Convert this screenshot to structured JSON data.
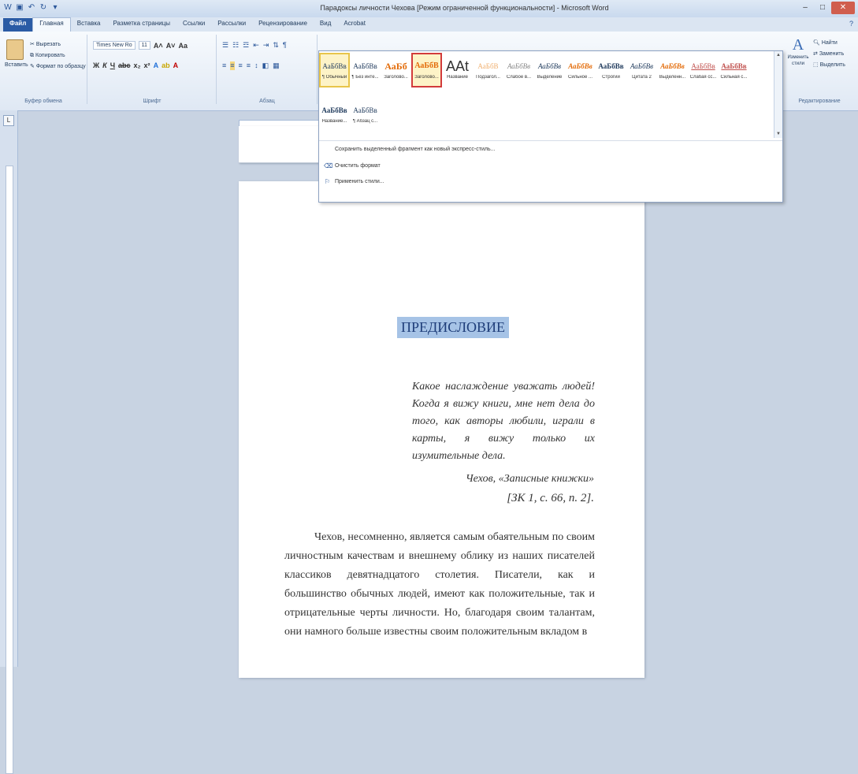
{
  "window": {
    "title": "Парадоксы личности Чехова [Режим ограниченной функциональности] - Microsoft Word"
  },
  "qat": [
    "word-icon",
    "save-icon",
    "undo-icon",
    "redo-icon",
    "customize-icon"
  ],
  "tabs": [
    {
      "label": "Файл"
    },
    {
      "label": "Главная"
    },
    {
      "label": "Вставка"
    },
    {
      "label": "Разметка страницы"
    },
    {
      "label": "Ссылки"
    },
    {
      "label": "Рассылки"
    },
    {
      "label": "Рецензирование"
    },
    {
      "label": "Вид"
    },
    {
      "label": "Acrobat"
    }
  ],
  "clipboard": {
    "paste": "Вставить",
    "cut": "Вырезать",
    "copy": "Копировать",
    "format_painter": "Формат по образцу",
    "group": "Буфер обмена"
  },
  "font": {
    "name": "Times New Ro",
    "size": "11",
    "group": "Шрифт"
  },
  "paragraph": {
    "group": "Абзац"
  },
  "editing": {
    "find": "Найти",
    "replace": "Заменить",
    "select": "Выделить",
    "change_styles": "Изменить стили",
    "group": "Редактирование"
  },
  "styles_row1": [
    {
      "sample": "АаБбВв",
      "name": "¶ Обычный"
    },
    {
      "sample": "АаБбВв",
      "name": "¶ Без инте..."
    },
    {
      "sample": "АаБб",
      "name": "Заголово..."
    },
    {
      "sample": "АаБбВ",
      "name": "Заголово..."
    },
    {
      "sample": "ААt",
      "name": "Название"
    },
    {
      "sample": "АаБбВ",
      "name": "Подзагол..."
    },
    {
      "sample": "АаБбВв",
      "name": "Слабое в..."
    },
    {
      "sample": "АаБбВв",
      "name": "Выделение"
    },
    {
      "sample": "АаБбВв",
      "name": "Сильное ..."
    },
    {
      "sample": "АаБбВв",
      "name": "Строгий"
    },
    {
      "sample": "АаБбВв",
      "name": "Цитата 2"
    },
    {
      "sample": "АаБбВв",
      "name": "Выделенн..."
    },
    {
      "sample": "АаБбВв",
      "name": "Слабая сс..."
    },
    {
      "sample": "АаБбВв",
      "name": "Сильная с..."
    }
  ],
  "styles_row2": [
    {
      "sample": "АаБбВв",
      "name": "Название..."
    },
    {
      "sample": "АаБбВв",
      "name": "¶ Абзац с..."
    }
  ],
  "gallery_commands": [
    {
      "label": "Сохранить выделенный фрагмент как новый экспресс-стиль..."
    },
    {
      "label": "Очистить формат"
    },
    {
      "label": "Применить стили..."
    }
  ],
  "document": {
    "heading": "ПРЕДИСЛОВИЕ",
    "epigraph": "Какое наслаждение уважать людей! Когда я вижу книги, мне нет дела до того, как авторы любили, играли в карты, я вижу только их изумительные дела.",
    "attribution1": "Чехов, «Записные книжки»",
    "attribution2": "[ЗК 1, с. 66, п. 2].",
    "body": "Чехов, несомненно, является самым обаятельным по своим личностным качествам и внешнему облику из наших писателей классиков девятнадцатого столетия. Писатели, как и большинство обычных людей, имеют как положительные, так и отрицательные черты личности. Но, благодаря своим талантам, они намного больше известны своим положительным вкладом в"
  }
}
